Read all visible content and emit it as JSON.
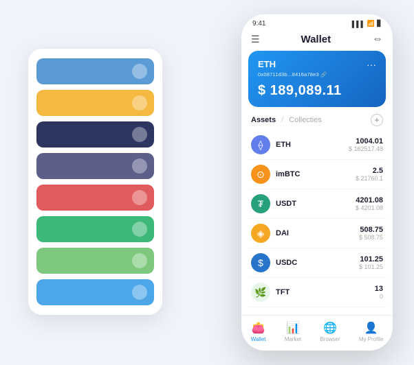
{
  "scene": {
    "card_stack": {
      "cards": [
        {
          "color": "#5b9bd5",
          "dot_color": "rgba(255,255,255,0.4)"
        },
        {
          "color": "#f5b942",
          "dot_color": "rgba(255,255,255,0.4)"
        },
        {
          "color": "#2d3561",
          "dot_color": "rgba(255,255,255,0.4)"
        },
        {
          "color": "#5c5f8a",
          "dot_color": "rgba(255,255,255,0.4)"
        },
        {
          "color": "#e05c5c",
          "dot_color": "rgba(255,255,255,0.4)"
        },
        {
          "color": "#3cb878",
          "dot_color": "rgba(255,255,255,0.4)"
        },
        {
          "color": "#7dc87d",
          "dot_color": "rgba(255,255,255,0.4)"
        },
        {
          "color": "#4da6e8",
          "dot_color": "rgba(255,255,255,0.4)"
        }
      ]
    }
  },
  "phone": {
    "status_bar": {
      "time": "9:41",
      "signal": "▌▌▌",
      "wifi": "WiFi",
      "battery": "🔋"
    },
    "header": {
      "menu_icon": "☰",
      "title": "Wallet",
      "expand_icon": "⇔"
    },
    "eth_card": {
      "coin": "ETH",
      "address": "0x08711d3b...8416a78e3 🔗",
      "balance": "$ 189,089.11",
      "dots": "···"
    },
    "assets_header": {
      "tab_active": "Assets",
      "tab_separator": "/",
      "tab_inactive": "Collecties",
      "add_icon": "+"
    },
    "assets": [
      {
        "name": "ETH",
        "icon": "⟠",
        "icon_bg": "#627eea",
        "balance": "1004.01",
        "usd": "$ 162517.48"
      },
      {
        "name": "imBTC",
        "icon": "⊙",
        "icon_bg": "#f7931a",
        "balance": "2.5",
        "usd": "$ 21760.1"
      },
      {
        "name": "USDT",
        "icon": "₮",
        "icon_bg": "#26a17b",
        "balance": "4201.08",
        "usd": "$ 4201.08"
      },
      {
        "name": "DAI",
        "icon": "◈",
        "icon_bg": "#f5a623",
        "balance": "508.75",
        "usd": "$ 508.75"
      },
      {
        "name": "USDC",
        "icon": "$",
        "icon_bg": "#2775ca",
        "balance": "101.25",
        "usd": "$ 101.25"
      },
      {
        "name": "TFT",
        "icon": "🌿",
        "icon_bg": "#e8f5e9",
        "balance": "13",
        "usd": "0"
      }
    ],
    "bottom_nav": [
      {
        "icon": "👛",
        "label": "Wallet",
        "active": true
      },
      {
        "icon": "📊",
        "label": "Market",
        "active": false
      },
      {
        "icon": "🌐",
        "label": "Browser",
        "active": false
      },
      {
        "icon": "👤",
        "label": "My Profile",
        "active": false
      }
    ]
  }
}
